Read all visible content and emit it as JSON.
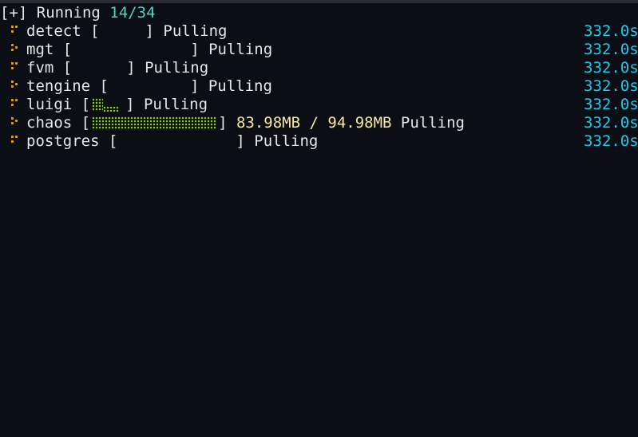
{
  "header": {
    "prefix": "[+] Running ",
    "done": "14",
    "sep": "/",
    "total": "34"
  },
  "services": [
    {
      "name": "detect",
      "status": "Pulling",
      "elapsed": "332.0s",
      "bar_chars": 3,
      "size": ""
    },
    {
      "name": "mgt",
      "status": "Pulling",
      "elapsed": "332.0s",
      "bar_chars": 13,
      "size": ""
    },
    {
      "name": "fvm",
      "status": "Pulling",
      "elapsed": "332.0s",
      "bar_chars": 5,
      "size": ""
    },
    {
      "name": "tengine",
      "status": "Pulling",
      "elapsed": "332.0s",
      "bar_chars": 9,
      "size": ""
    },
    {
      "name": "luigi",
      "status": "Pulling",
      "elapsed": "332.0s",
      "bar_chars": 3,
      "size": ""
    },
    {
      "name": "chaos",
      "status": "Pulling",
      "elapsed": "332.0s",
      "bar_chars": 13,
      "size": "83.98MB / 94.98MB"
    },
    {
      "name": "postgres",
      "status": "Pulling",
      "elapsed": "332.0s",
      "bar_chars": 13,
      "size": ""
    }
  ],
  "colors": {
    "background": "#0b0e14",
    "text": "#e6e6e6",
    "count": "#4fd1c5",
    "elapsed": "#22c8e8",
    "spinner": "#f0a30a",
    "progress": "#84cc16",
    "size": "#f5e6a3"
  },
  "icons": {
    "spinner": "braille-spinner-icon",
    "progress": "braille-progress-fill"
  }
}
